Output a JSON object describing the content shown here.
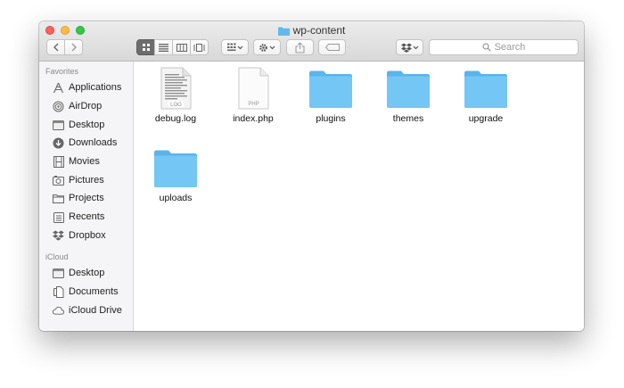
{
  "window": {
    "title": "wp-content"
  },
  "toolbar": {
    "back_label": "Back",
    "forward_label": "Forward",
    "search_placeholder": "Search"
  },
  "sidebar": {
    "favorites_heading": "Favorites",
    "favorites": [
      {
        "label": "Applications",
        "icon": "applications-icon"
      },
      {
        "label": "AirDrop",
        "icon": "airdrop-icon"
      },
      {
        "label": "Desktop",
        "icon": "desktop-icon"
      },
      {
        "label": "Downloads",
        "icon": "downloads-icon"
      },
      {
        "label": "Movies",
        "icon": "movies-icon"
      },
      {
        "label": "Pictures",
        "icon": "pictures-icon"
      },
      {
        "label": "Projects",
        "icon": "folder-icon"
      },
      {
        "label": "Recents",
        "icon": "recents-icon"
      },
      {
        "label": "Dropbox",
        "icon": "dropbox-icon"
      }
    ],
    "icloud_heading": "iCloud",
    "icloud": [
      {
        "label": "Desktop",
        "icon": "desktop-icon"
      },
      {
        "label": "Documents",
        "icon": "documents-icon"
      },
      {
        "label": "iCloud Drive",
        "icon": "cloud-icon"
      }
    ]
  },
  "files": [
    {
      "name": "debug.log",
      "type": "log",
      "badge": "LOG"
    },
    {
      "name": "index.php",
      "type": "php",
      "badge": "PHP"
    },
    {
      "name": "plugins",
      "type": "folder"
    },
    {
      "name": "themes",
      "type": "folder"
    },
    {
      "name": "upgrade",
      "type": "folder"
    },
    {
      "name": "uploads",
      "type": "folder"
    }
  ],
  "colors": {
    "folder": "#6fc3f3",
    "folder_tab": "#5ab4ea",
    "close": "#fc605c",
    "minimize": "#fdbc40",
    "maximize": "#34c84a"
  }
}
